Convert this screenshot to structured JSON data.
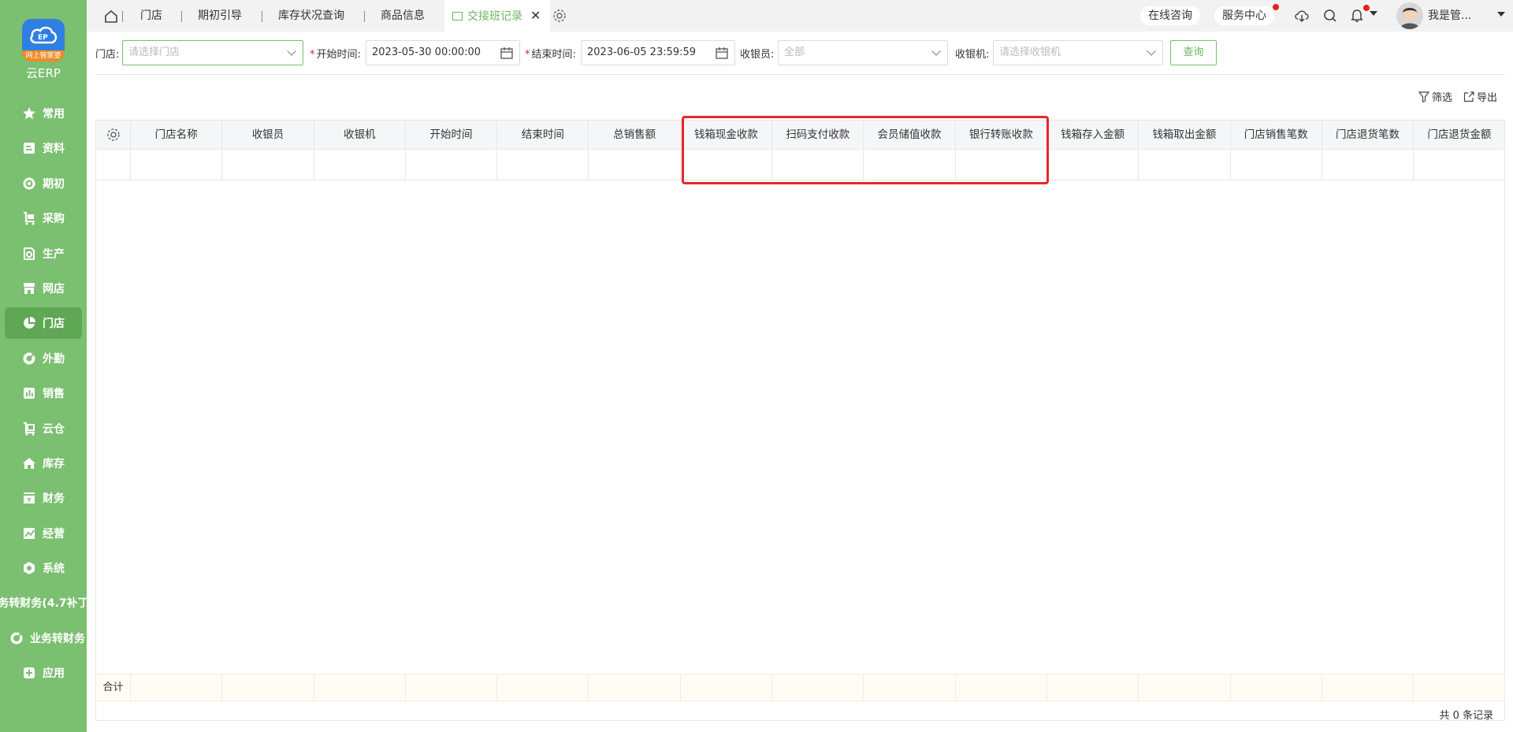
{
  "app": {
    "logo_tag": "网上管家婆",
    "logo_text": "云ERP"
  },
  "sidebar": {
    "items": [
      {
        "label": "常用",
        "icon": "star-icon"
      },
      {
        "label": "资料",
        "icon": "document-icon"
      },
      {
        "label": "期初",
        "icon": "target-icon"
      },
      {
        "label": "采购",
        "icon": "cart-icon"
      },
      {
        "label": "生产",
        "icon": "factory-icon"
      },
      {
        "label": "网店",
        "icon": "shop-icon"
      },
      {
        "label": "门店",
        "icon": "pie-chart-icon",
        "active": true
      },
      {
        "label": "外勤",
        "icon": "compass-icon"
      },
      {
        "label": "销售",
        "icon": "bar-chart-icon"
      },
      {
        "label": "云仓",
        "icon": "warehouse-icon"
      },
      {
        "label": "库存",
        "icon": "house-icon"
      },
      {
        "label": "财务",
        "icon": "ledger-icon"
      },
      {
        "label": "经营",
        "icon": "trend-icon"
      },
      {
        "label": "系统",
        "icon": "hexagon-gear-icon"
      },
      {
        "label": "务转财务(4.7补丁",
        "icon": ""
      },
      {
        "label": "业务转财务",
        "icon": "target-icon"
      },
      {
        "label": "应用",
        "icon": "plus-square-icon"
      }
    ]
  },
  "tabs": [
    {
      "label": "门店"
    },
    {
      "label": "期初引导"
    },
    {
      "label": "库存状况查询"
    },
    {
      "label": "商品信息"
    },
    {
      "label": "交接班记录",
      "active": true
    }
  ],
  "header": {
    "online_consult": "在线咨询",
    "service_center": "服务中心",
    "user_name": "我是管..."
  },
  "filter": {
    "store_label": "门店:",
    "store_placeholder": "请选择门店",
    "start_label": "开始时间:",
    "start_value": "2023-05-30 00:00:00",
    "end_label": "结束时间:",
    "end_value": "2023-06-05 23:59:59",
    "cashier_label": "收银员:",
    "cashier_value": "全部",
    "register_label": "收银机:",
    "register_placeholder": "请选择收银机",
    "query_button": "查询"
  },
  "toolbar": {
    "filter_label": "筛选",
    "export_label": "导出"
  },
  "table": {
    "columns": [
      "门店名称",
      "收银员",
      "收银机",
      "开始时间",
      "结束时间",
      "总销售额",
      "钱箱现金收款",
      "扫码支付收款",
      "会员储值收款",
      "银行转账收款",
      "钱箱存入金额",
      "钱箱取出金额",
      "门店销售笔数",
      "门店退货笔数",
      "门店退货金额"
    ],
    "footer_label": "合计",
    "record_count": "共 0 条记录"
  },
  "colors": {
    "sidebar": "#7bbf70",
    "accent": "#6cb660",
    "highlight": "#e8262a"
  }
}
